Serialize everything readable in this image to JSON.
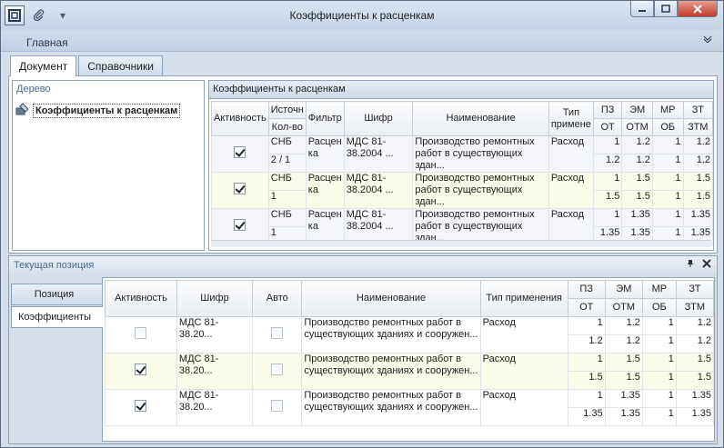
{
  "window": {
    "title": "Коэффициенты к расценкам"
  },
  "ribbon": {
    "tab": "Главная"
  },
  "main_tabs": [
    {
      "label": "Документ"
    },
    {
      "label": "Справочники"
    }
  ],
  "tree": {
    "header": "Дерево",
    "item": "Коэффициенты к расценкам"
  },
  "top_grid": {
    "caption": "Коэффициенты к расценкам",
    "headers": {
      "active": "Активность",
      "source": "Источн",
      "qty": "Кол-во",
      "filter": "Фильтр",
      "code": "Шифр",
      "name": "Наименование",
      "type": "Тип примене",
      "pz": "ПЗ",
      "ot": "ОТ",
      "em": "ЭМ",
      "otm": "ОТМ",
      "mr": "МР",
      "ob": "ОБ",
      "zt": "ЗТ",
      "ztm": "ЗТМ"
    },
    "rows": [
      {
        "active": true,
        "source": "СНБ",
        "qty": "2 / 1",
        "filter": "Расценка",
        "code": "МДС 81-38.2004 ...",
        "name": "Производство ремонтных работ в существующих здан...",
        "type": "Расход",
        "pz": "1",
        "em": "1.2",
        "mr": "1",
        "zt": "1.2",
        "ot": "1.2",
        "otm": "1.2",
        "ob": "1",
        "ztm": "1.2"
      },
      {
        "active": true,
        "source": "СНБ",
        "qty": "1",
        "filter": "Расценка",
        "code": "МДС 81-38.2004 ...",
        "name": "Производство ремонтных работ в существующих здан...",
        "type": "Расход",
        "pz": "1",
        "em": "1.5",
        "mr": "1",
        "zt": "1.5",
        "ot": "1.5",
        "otm": "1.5",
        "ob": "1",
        "ztm": "1.5"
      },
      {
        "active": true,
        "source": "СНБ",
        "qty": "1",
        "filter": "Расценка",
        "code": "МДС 81-38.2004 ...",
        "name": "Производство ремонтных работ в существующих здан...",
        "type": "Расход",
        "pz": "1",
        "em": "1.35",
        "mr": "1",
        "zt": "1.35",
        "ot": "1.35",
        "otm": "1.35",
        "ob": "1",
        "ztm": "1.35"
      }
    ]
  },
  "dock": {
    "title": "Текущая позиция",
    "pin_icon": "pin-icon",
    "close_icon": "close-icon",
    "side_tabs": [
      {
        "label": "Позиция"
      },
      {
        "label": "Коэффициенты"
      }
    ]
  },
  "bottom_grid": {
    "headers": {
      "active": "Активность",
      "code": "Шифр",
      "auto": "Авто",
      "name": "Наименование",
      "type": "Тип применения",
      "pz": "ПЗ",
      "ot": "ОТ",
      "em": "ЭМ",
      "otm": "ОТМ",
      "mr": "МР",
      "ob": "ОБ",
      "zt": "ЗТ",
      "ztm": "ЗТМ"
    },
    "rows": [
      {
        "active": false,
        "auto": false,
        "code": "МДС 81-38.20...",
        "name": "Производство ремонтных работ в существующих зданиях и сооружен...",
        "type": "Расход",
        "pz": "1",
        "em": "1.2",
        "mr": "1",
        "zt": "1.2",
        "ot": "1.2",
        "otm": "1.2",
        "ob": "1",
        "ztm": "1.2"
      },
      {
        "active": true,
        "auto": false,
        "code": "МДС 81-38.20...",
        "name": "Производство ремонтных работ в существующих зданиях и сооружен...",
        "type": "Расход",
        "pz": "1",
        "em": "1.5",
        "mr": "1",
        "zt": "1.5",
        "ot": "1.5",
        "otm": "1.5",
        "ob": "1",
        "ztm": "1.5"
      },
      {
        "active": true,
        "auto": false,
        "code": "МДС 81-38.20...",
        "name": "Производство ремонтных работ в существующих зданиях и сооружен...",
        "type": "Расход",
        "pz": "1",
        "em": "1.35",
        "mr": "1",
        "zt": "1.35",
        "ot": "1.35",
        "otm": "1.35",
        "ob": "1",
        "ztm": "1.35"
      }
    ]
  }
}
